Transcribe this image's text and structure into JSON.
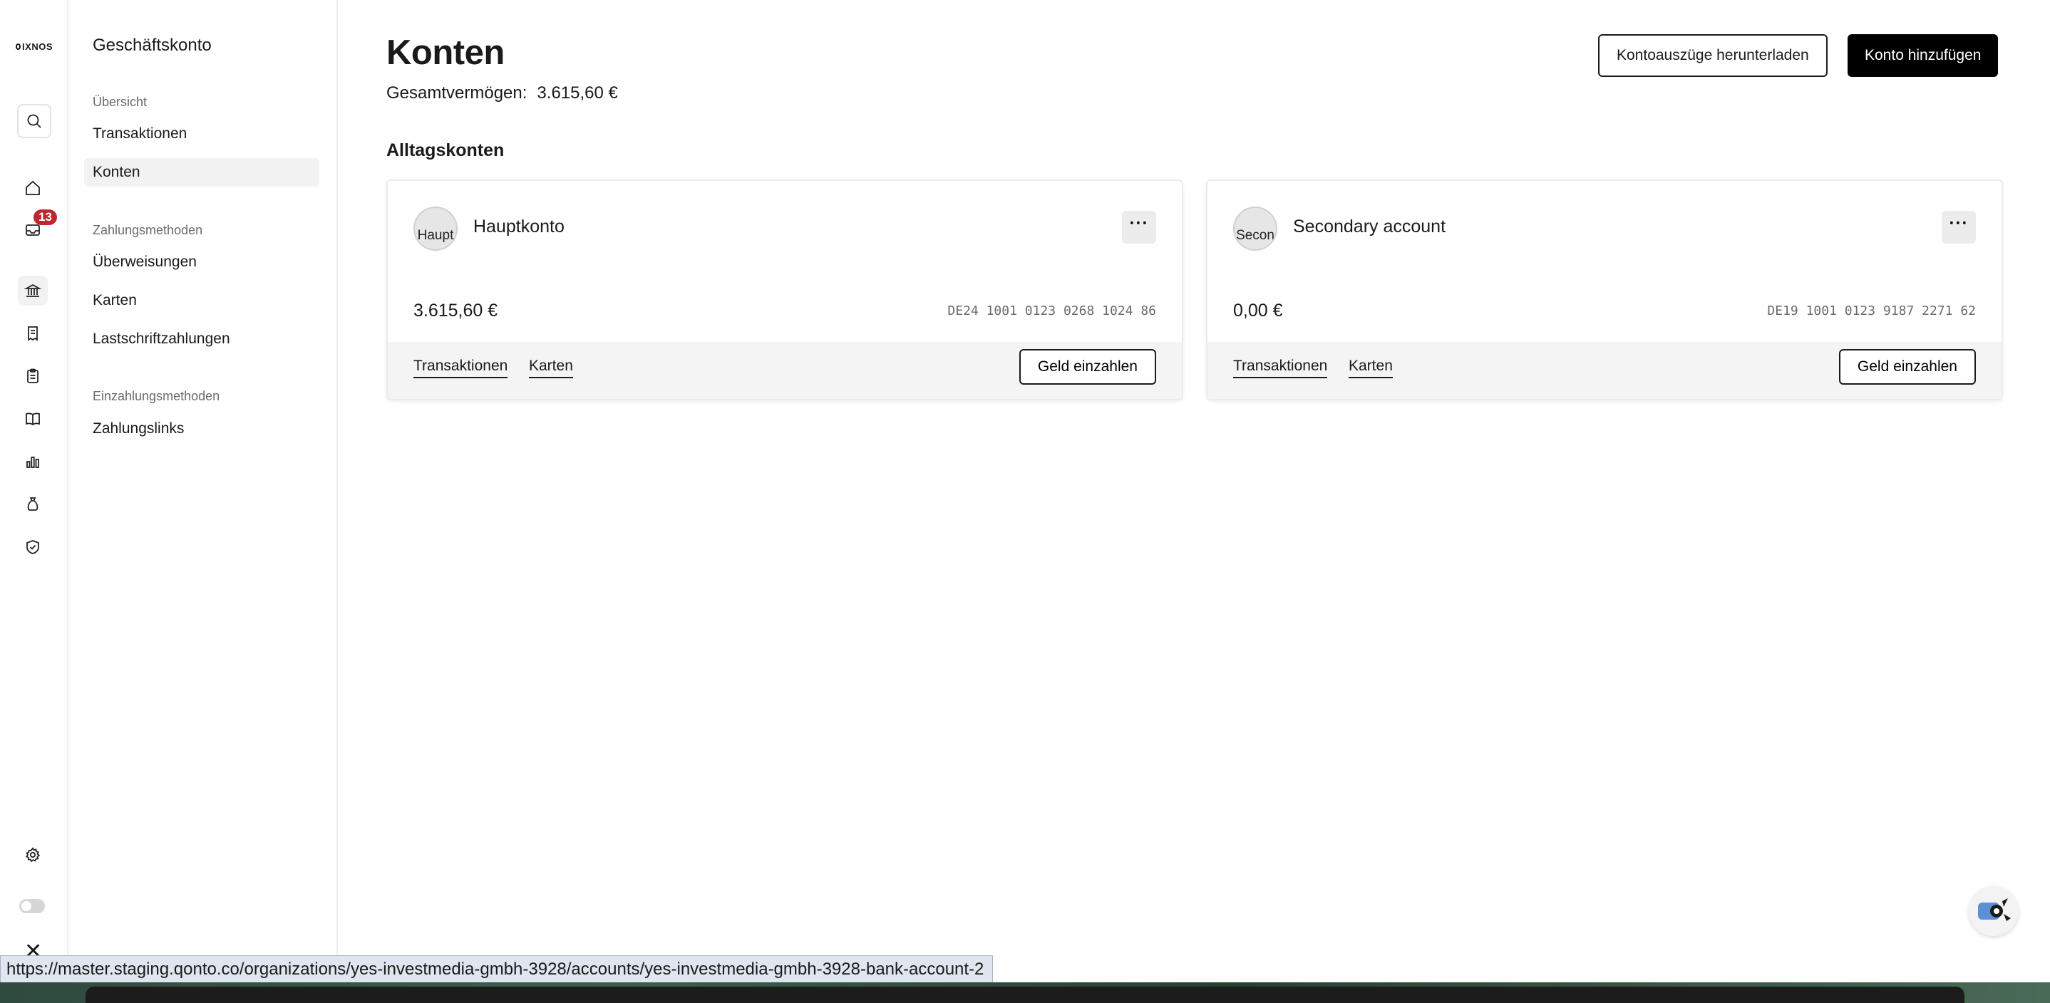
{
  "rail": {
    "logo_text": "IXNOS",
    "notification_count": "13",
    "icons": [
      "search-icon",
      "home-icon",
      "inbox-icon",
      "bank-icon",
      "receipt-icon",
      "clipboard-icon",
      "book-icon",
      "bar-chart-icon",
      "money-bag-icon",
      "shield-icon",
      "gear-icon",
      "theme-toggle-icon",
      "close-icon"
    ]
  },
  "sidebar": {
    "title": "Geschäftskonto",
    "sections": [
      {
        "label": "Übersicht",
        "items": [
          "Transaktionen",
          "Konten"
        ]
      },
      {
        "label": "Zahlungsmethoden",
        "items": [
          "Überweisungen",
          "Karten",
          "Lastschriftzahlungen"
        ]
      },
      {
        "label": "Einzahlungsmethoden",
        "items": [
          "Zahlungslinks"
        ]
      }
    ],
    "active_item": "Konten"
  },
  "main": {
    "title": "Konten",
    "total_label": "Gesamtvermögen:",
    "total_value": "3.615,60 €",
    "download_button": "Kontoauszüge herunterladen",
    "add_button": "Konto hinzufügen",
    "section_title": "Alltagskonten",
    "accounts": [
      {
        "avatar_alt": "Haupt",
        "name": "Hauptkonto",
        "balance": "3.615,60 €",
        "iban": "DE24 1001 0123 0268 1024 86",
        "link_transactions": "Transaktionen",
        "link_cards": "Karten",
        "deposit_button": "Geld einzahlen"
      },
      {
        "avatar_alt": "Secon",
        "name": "Secondary account",
        "balance": "0,00 €",
        "iban": "DE19 1001 0123 9187 2271 62",
        "link_transactions": "Transaktionen",
        "link_cards": "Karten",
        "deposit_button": "Geld einzahlen"
      }
    ]
  },
  "status_bar": {
    "url": "https://master.staging.qonto.co/organizations/yes-investmedia-gmbh-3928/accounts/yes-investmedia-gmbh-3928-bank-account-2"
  },
  "colors": {
    "badge": "#c0262d",
    "primary_button": "#000000",
    "active_item_bg": "#f2f2f2"
  }
}
